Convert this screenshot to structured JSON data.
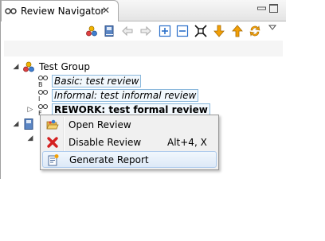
{
  "view": {
    "tab_title": "Review Navigator",
    "tab_close": "✕"
  },
  "toolbar": {
    "buttons": [
      "group-icon",
      "book-icon",
      "back-icon",
      "forward-icon",
      "expand-all-icon",
      "collapse-all-icon",
      "filter-icon",
      "arrow-down-icon",
      "arrow-up-icon",
      "sync-icon",
      "view-menu-icon"
    ]
  },
  "tree": {
    "group": {
      "label": "Test Group",
      "expanded": true
    },
    "reviews": [
      {
        "label": "Basic: test review",
        "bold": false
      },
      {
        "label": "Informal: test informal review",
        "bold": false
      },
      {
        "label": "REWORK: test formal review",
        "bold": true
      }
    ]
  },
  "context_menu": {
    "items": [
      {
        "label": "Open Review",
        "icon": "folder-open-icon",
        "shortcut": ""
      },
      {
        "label": "Disable Review",
        "icon": "red-x-icon",
        "shortcut": "Alt+4, X"
      },
      {
        "label": "Generate Report",
        "icon": "report-icon",
        "shortcut": ""
      }
    ]
  },
  "colors": {
    "selection_border": "#8bb8dc",
    "menu_highlight": "#dde9f7",
    "toolbar_blue": "#2a6fc9",
    "toolbar_orange": "#f2a007"
  }
}
